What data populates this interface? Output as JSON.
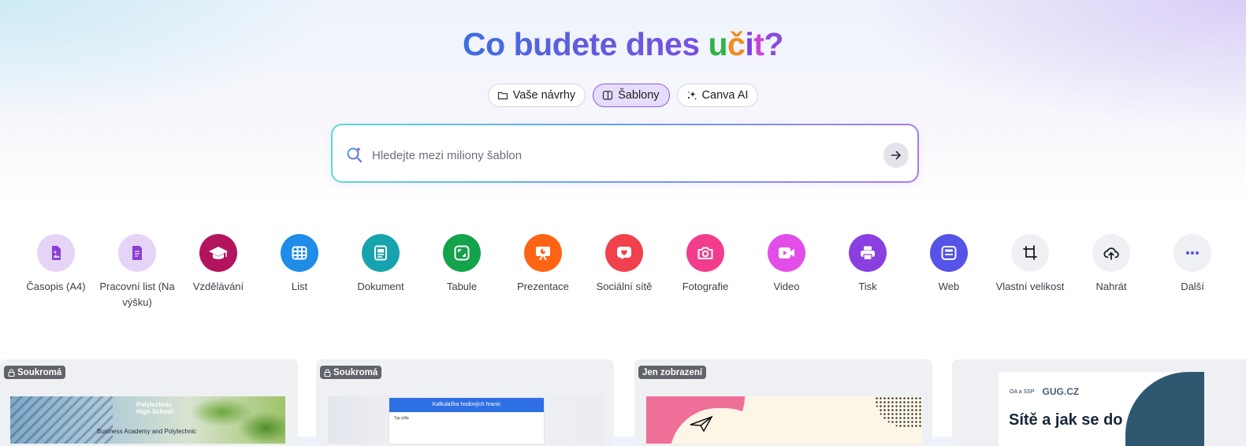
{
  "hero": {
    "title_main": "Co budete dnes ",
    "title_word": [
      "u",
      "č",
      "i",
      "t"
    ],
    "title_q": "?"
  },
  "tabs": [
    {
      "label": "Vaše návrhy",
      "icon": "folder-icon",
      "active": false
    },
    {
      "label": "Šablony",
      "icon": "template-icon",
      "active": true
    },
    {
      "label": "Canva AI",
      "icon": "sparkle-icon",
      "active": false
    }
  ],
  "search": {
    "placeholder": "Hledejte mezi miliony šablon",
    "value": ""
  },
  "categories": [
    {
      "label": "Časopis (A4)",
      "icon": "magazine-icon",
      "bg": "#e6d4f7",
      "fg": "#8a3fd1"
    },
    {
      "label": "Pracovní list (Na výšku)",
      "icon": "worksheet-icon",
      "bg": "#e6d4f7",
      "fg": "#8a3fd1"
    },
    {
      "label": "Vzdělávání",
      "icon": "graduation-cap-icon",
      "bg": "#b3145e",
      "fg": "#ffffff"
    },
    {
      "label": "List",
      "icon": "sheet-icon",
      "bg": "#1f8ce8",
      "fg": "#ffffff"
    },
    {
      "label": "Dokument",
      "icon": "document-icon",
      "bg": "#17a3ad",
      "fg": "#ffffff"
    },
    {
      "label": "Tabule",
      "icon": "whiteboard-icon",
      "bg": "#14a24a",
      "fg": "#ffffff"
    },
    {
      "label": "Prezentace",
      "icon": "presentation-icon",
      "bg": "#ff6414",
      "fg": "#ffffff"
    },
    {
      "label": "Sociální sítě",
      "icon": "heart-icon",
      "bg": "#f0414c",
      "fg": "#ffffff"
    },
    {
      "label": "Fotografie",
      "icon": "camera-icon",
      "bg": "#f23d8f",
      "fg": "#ffffff"
    },
    {
      "label": "Video",
      "icon": "video-icon",
      "bg": "#e34ee8",
      "fg": "#ffffff"
    },
    {
      "label": "Tisk",
      "icon": "printer-icon",
      "bg": "#8a3fe0",
      "fg": "#ffffff"
    },
    {
      "label": "Web",
      "icon": "web-icon",
      "bg": "#5553e8",
      "fg": "#ffffff"
    },
    {
      "label": "Vlastní velikost",
      "icon": "custom-size-icon",
      "bg": "#eef0f3",
      "fg": "#1a1d24"
    },
    {
      "label": "Nahrát",
      "icon": "upload-cloud-icon",
      "bg": "#eef0f3",
      "fg": "#1a1d24"
    },
    {
      "label": "Další",
      "icon": "more-icon",
      "bg": "#eef0f3",
      "fg": "#5553e8"
    }
  ],
  "cards": [
    {
      "badge": "Soukromá",
      "badge_icon": "lock-icon",
      "thumb_text_1": "Polytechnic",
      "thumb_text_2": "High School",
      "thumb_text_3": "Business Academy and Polytechnic"
    },
    {
      "badge": "Soukromá",
      "badge_icon": "lock-icon",
      "thumb_text_1": "Kalkulačka hodových hranic",
      "thumb_text_2": "Typ jídla",
      "thumb_text_3": ""
    },
    {
      "badge": "Jen zobrazení",
      "badge_icon": "",
      "thumb_text_1": "",
      "thumb_text_2": "",
      "thumb_text_3": ""
    },
    {
      "badge": "",
      "badge_icon": "",
      "thumb_text_1": "OA a SSP",
      "thumb_text_2": "GUG.CZ",
      "thumb_text_3": "Sítě a jak se do"
    }
  ]
}
